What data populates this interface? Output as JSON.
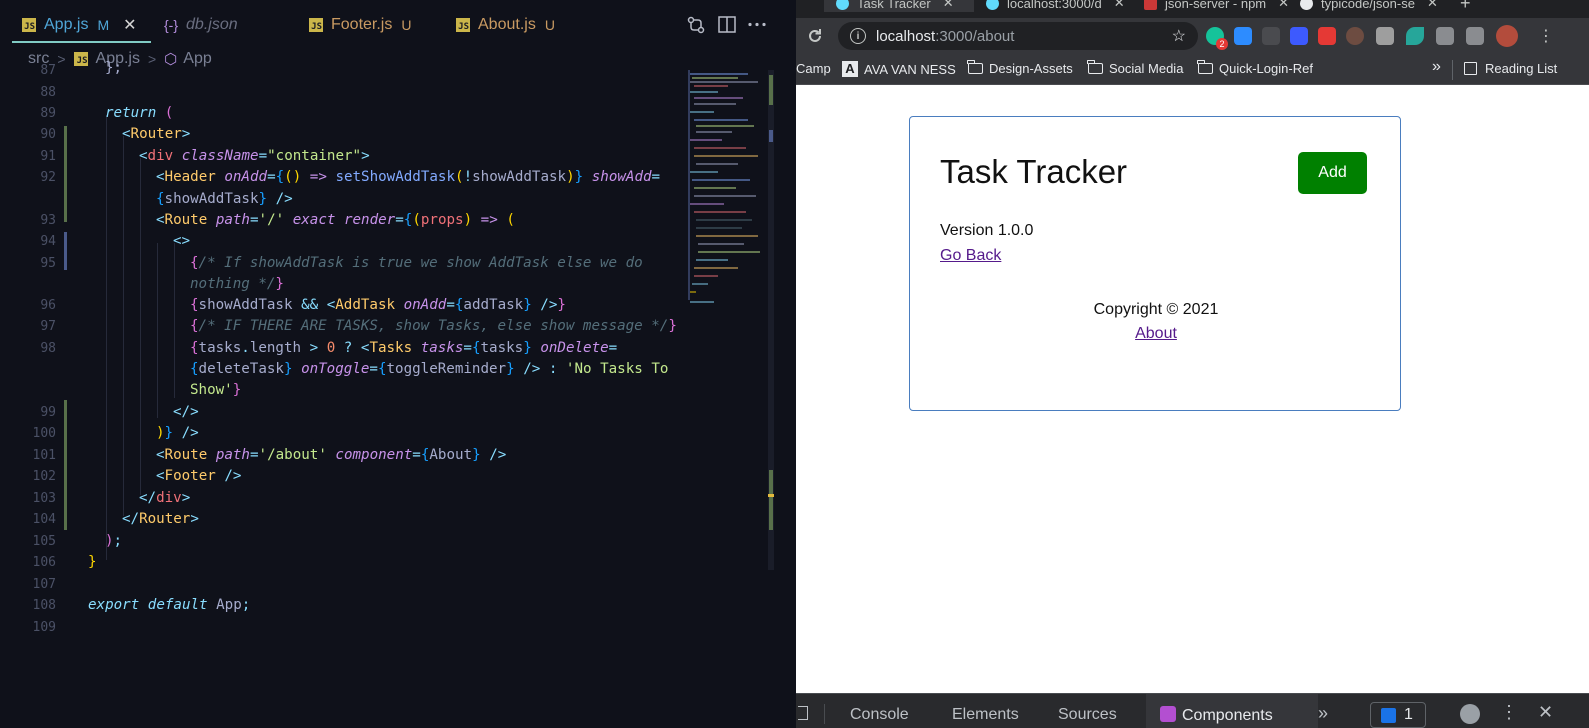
{
  "editor": {
    "tabs": [
      {
        "name": "App.js",
        "status": "M",
        "color": "#4fa6d8",
        "has_close": true
      },
      {
        "name": "db.json",
        "status": "",
        "color": "#6a6e80"
      },
      {
        "name": "Footer.js",
        "status": "U",
        "color": "#c99a62"
      },
      {
        "name": "About.js",
        "status": "U",
        "color": "#c99a62"
      }
    ],
    "js_badge": "JS",
    "json_badge": "{-}",
    "close_glyph": "✕",
    "breadcrumb": {
      "folder": "src",
      "file": "App.js",
      "symbol": "App"
    },
    "top_partial_line": {
      "number": "87",
      "text": "};"
    },
    "line_numbers": [
      "88",
      "89",
      "90",
      "91",
      "92",
      "",
      "93",
      "94",
      "95",
      "",
      "96",
      "97",
      "98",
      "",
      "",
      "99",
      "100",
      "101",
      "102",
      "103",
      "104",
      "105",
      "106",
      "107",
      "108",
      "109"
    ],
    "code": {
      "l89_kw": "return",
      "l89_paren": "(",
      "router_open": "Router",
      "div_tag": "div",
      "classname_attr": "className",
      "container_val": "\"container\"",
      "header_tag": "Header",
      "onadd_attr": "onAdd",
      "arrow": "=>",
      "setshow_fn": "setShowAddTask",
      "bang": "!",
      "showaddtask": "showAddTask",
      "showadd_attr": "showAdd",
      "route_tag": "Route",
      "path_attr": "path",
      "root_path": "'/'",
      "exact_attr": "exact",
      "render_attr": "render",
      "props": "props",
      "comment1a": "/* If showAddTask is true we show AddTask else we do",
      "comment1b": "nothing */",
      "and_op": "&&",
      "addtask_tag": "AddTask",
      "addtask_var": "addTask",
      "comment2": "/* IF THERE ARE TASKS, show Tasks, else show message */",
      "tasks_var": "tasks",
      "length_prop": "length",
      "gt": ">",
      "zero": "0",
      "qmark": "?",
      "tasks_tag": "Tasks",
      "tasks_attr": "tasks",
      "ondelete_attr": "onDelete",
      "deletetask": "deleteTask",
      "ontoggle_attr": "onToggle",
      "togglereminder": "toggleReminder",
      "colon": ":",
      "no_tasks_a": "'No Tasks To",
      "no_tasks_b": "Show'",
      "about_path": "'/about'",
      "component_attr": "component",
      "about_comp": "About",
      "footer_tag": "Footer",
      "export_kw": "export",
      "default_kw": "default",
      "app_name": "App"
    }
  },
  "browser": {
    "tabs": [
      {
        "title": "Task Tracker"
      },
      {
        "title": "localhost:3000/d"
      },
      {
        "title": "json-server - npm"
      },
      {
        "title": "typicode/json-se"
      }
    ],
    "new_tab": "+",
    "tab_close": "✕",
    "address_host": "localhost",
    "address_rest": ":3000/about",
    "extension_badge": "2",
    "bookmarks": [
      "Camp",
      "AVA VAN NESS",
      "Design-Assets",
      "Social Media",
      "Quick-Login-Ref"
    ],
    "bookmarks_more": "»",
    "reading_list": "Reading List",
    "page": {
      "title": "Task Tracker",
      "add_button": "Add",
      "version": "Version 1.0.0",
      "go_back": "Go Back",
      "copyright": "Copyright © 2021",
      "about": "About"
    },
    "devtools": {
      "tabs": [
        "Console",
        "Elements",
        "Sources",
        "Components"
      ],
      "more": "»",
      "issues_count": "1"
    }
  },
  "colors": {
    "accent_teal": "#80cbc4",
    "add_green": "#008000",
    "link_purple": "#551a8b"
  }
}
